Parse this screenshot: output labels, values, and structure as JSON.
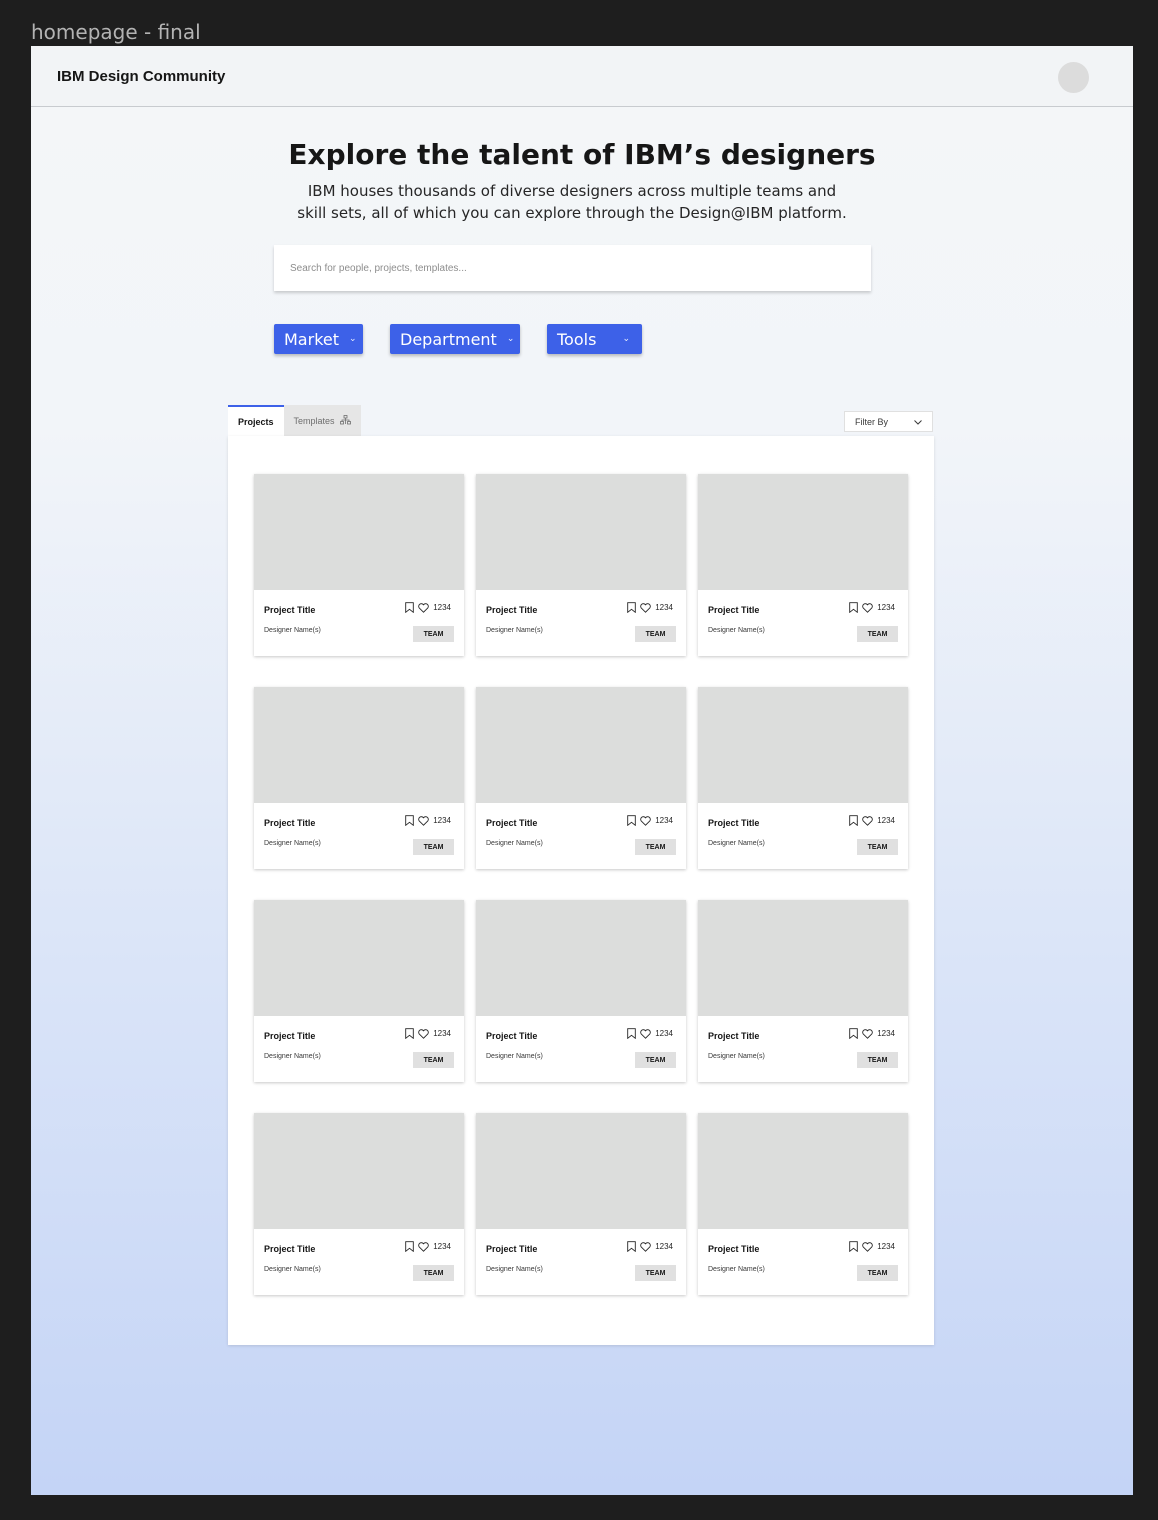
{
  "frame": {
    "label": "homepage - final"
  },
  "header": {
    "brand": "IBM Design Community"
  },
  "hero": {
    "title": "Explore the talent of IBM’s designers",
    "subtitle": "IBM houses thousands of diverse designers across multiple teams and skill sets, all of which you can explore through the Design@IBM platform."
  },
  "search": {
    "placeholder": "Search for people, projects, templates..."
  },
  "filters": [
    {
      "label": "Market"
    },
    {
      "label": "Department"
    },
    {
      "label": "Tools"
    }
  ],
  "tabs": [
    {
      "label": "Projects",
      "active": true
    },
    {
      "label": "Templates",
      "active": false
    }
  ],
  "filter_by": {
    "label": "Filter By"
  },
  "accent_color": "#3d61e8",
  "cards": [
    {
      "title": "Project Title",
      "designer": "Designer Name(s)",
      "likes": "1234",
      "badge": "TEAM"
    },
    {
      "title": "Project Title",
      "designer": "Designer Name(s)",
      "likes": "1234",
      "badge": "TEAM"
    },
    {
      "title": "Project Title",
      "designer": "Designer Name(s)",
      "likes": "1234",
      "badge": "TEAM"
    },
    {
      "title": "Project Title",
      "designer": "Designer Name(s)",
      "likes": "1234",
      "badge": "TEAM"
    },
    {
      "title": "Project Title",
      "designer": "Designer Name(s)",
      "likes": "1234",
      "badge": "TEAM"
    },
    {
      "title": "Project Title",
      "designer": "Designer Name(s)",
      "likes": "1234",
      "badge": "TEAM"
    },
    {
      "title": "Project Title",
      "designer": "Designer Name(s)",
      "likes": "1234",
      "badge": "TEAM"
    },
    {
      "title": "Project Title",
      "designer": "Designer Name(s)",
      "likes": "1234",
      "badge": "TEAM"
    },
    {
      "title": "Project Title",
      "designer": "Designer Name(s)",
      "likes": "1234",
      "badge": "TEAM"
    },
    {
      "title": "Project Title",
      "designer": "Designer Name(s)",
      "likes": "1234",
      "badge": "TEAM"
    },
    {
      "title": "Project Title",
      "designer": "Designer Name(s)",
      "likes": "1234",
      "badge": "TEAM"
    },
    {
      "title": "Project Title",
      "designer": "Designer Name(s)",
      "likes": "1234",
      "badge": "TEAM"
    }
  ]
}
